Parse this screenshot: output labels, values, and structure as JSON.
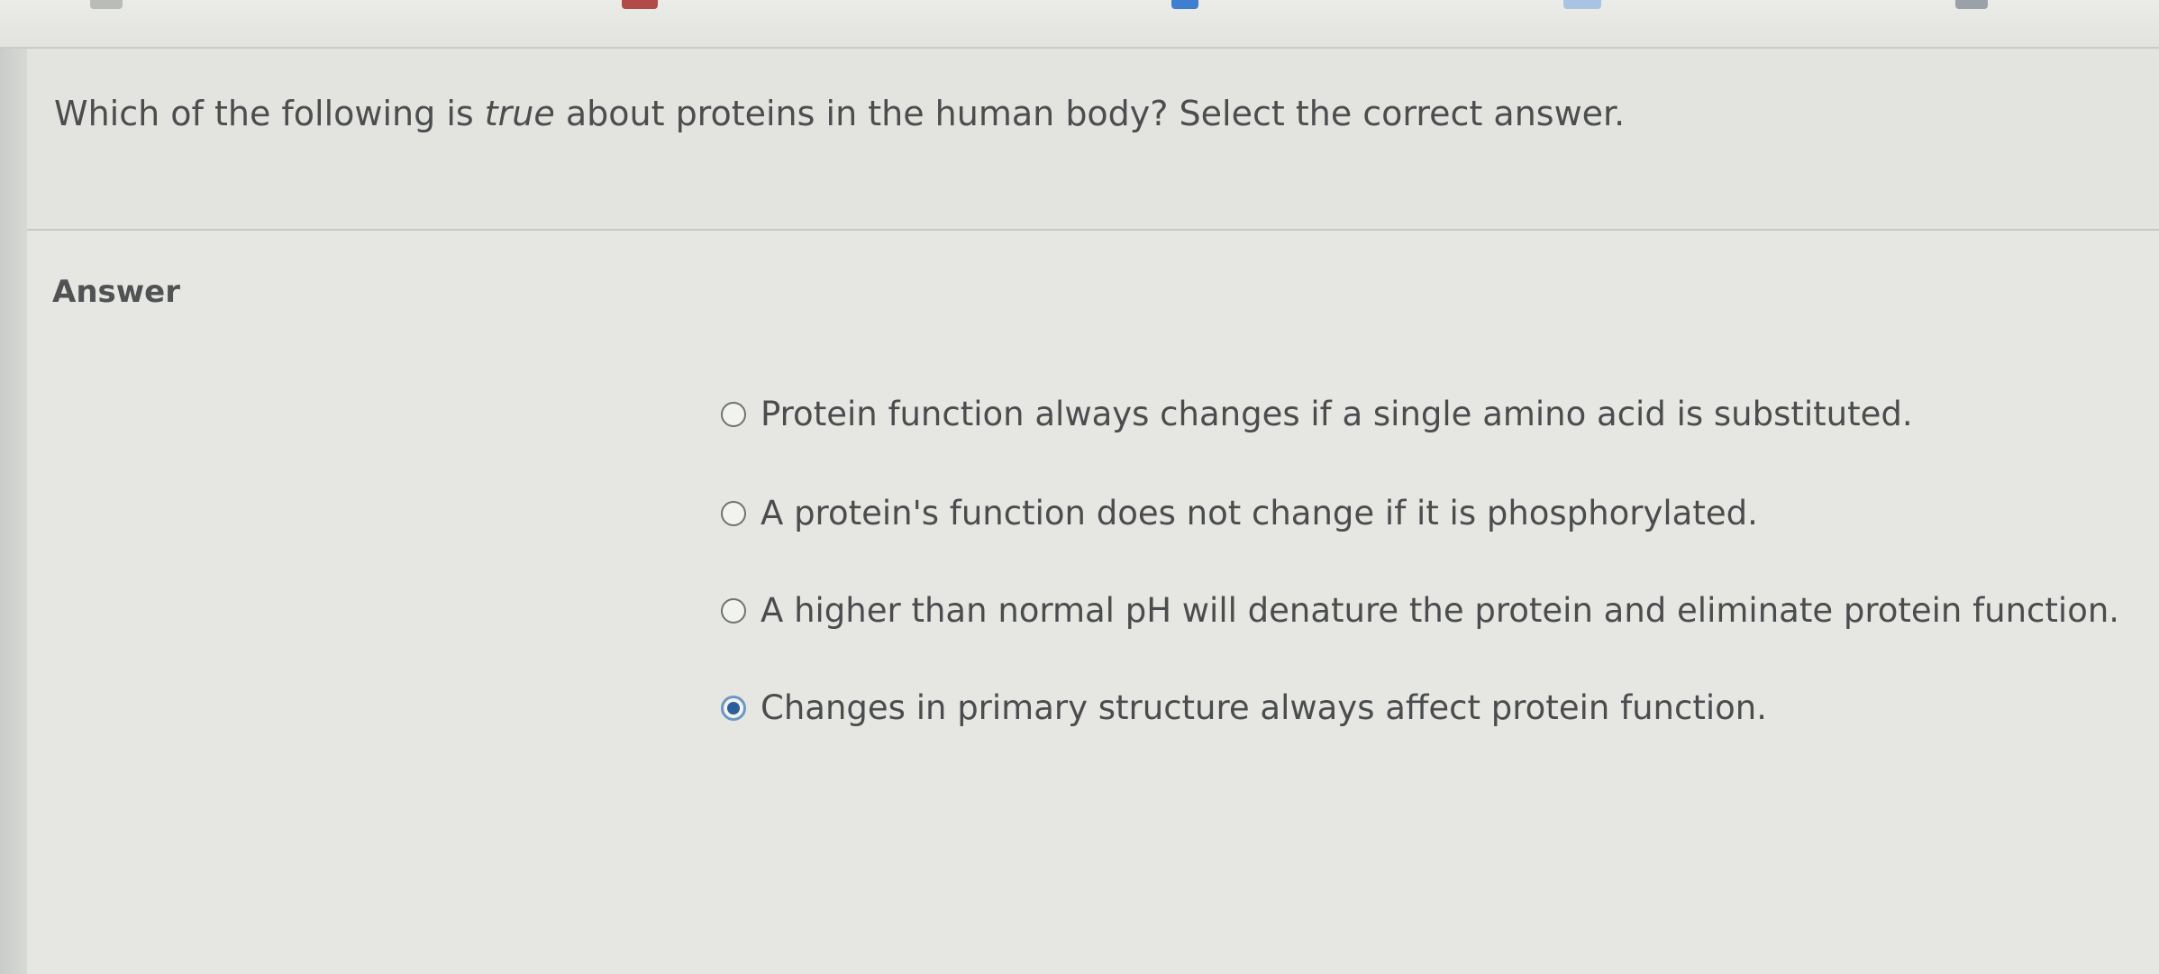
{
  "question": {
    "text_before": "Which of the following is ",
    "text_emphasis": "true",
    "text_after": " about proteins in the human body? Select the correct answer."
  },
  "answer": {
    "heading": "Answer",
    "options": [
      {
        "label": "Protein function always changes if a single amino acid is substituted.",
        "selected": false
      },
      {
        "label": "A protein's function does not change if it is phosphorylated.",
        "selected": false
      },
      {
        "label": "A higher than normal pH will denature the protein and eliminate protein function.",
        "selected": false
      },
      {
        "label": "Changes in primary structure always affect protein function.",
        "selected": true
      }
    ]
  },
  "colors": {
    "background": "#e6e7e2",
    "text": "#4a4c4e",
    "radio_selected": "#2c5f99"
  }
}
